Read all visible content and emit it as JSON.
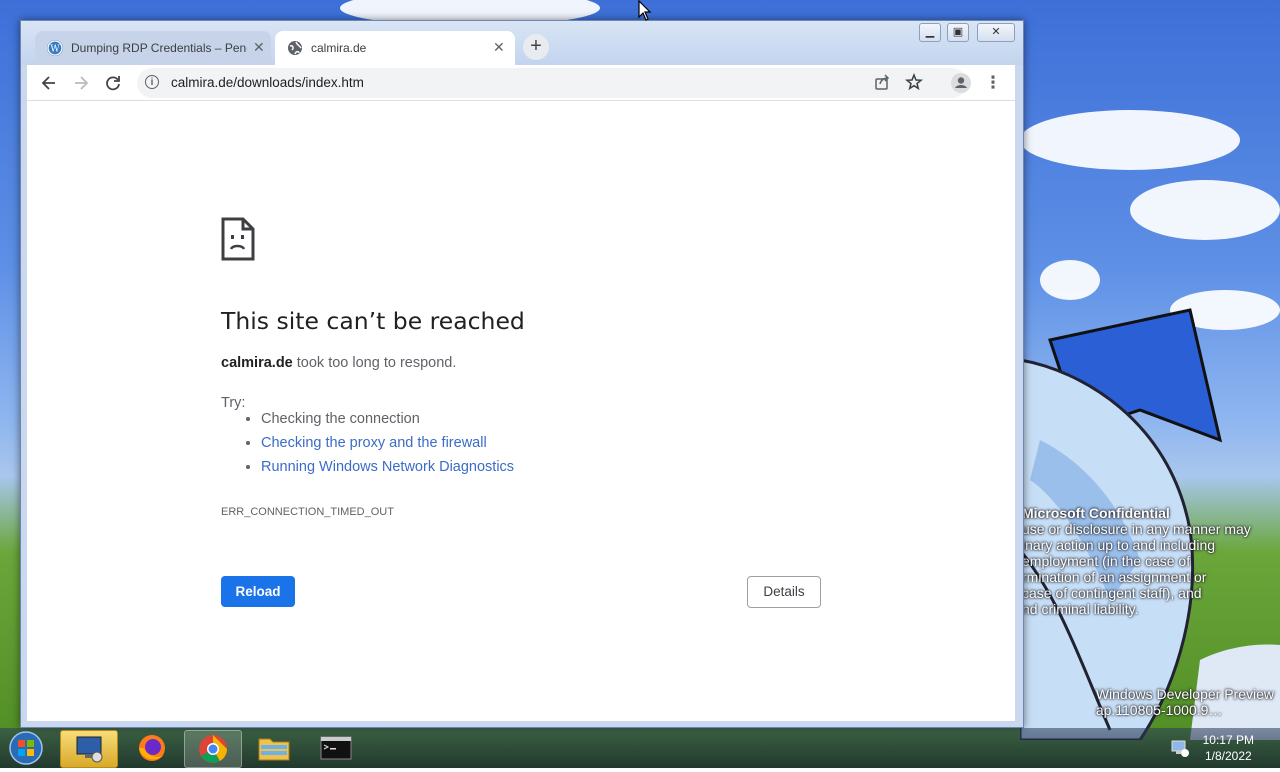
{
  "tabs": [
    {
      "title": "Dumping RDP Credentials – Pene",
      "icon": "wordpress-icon"
    },
    {
      "title": "calmira.de",
      "icon": "globe-icon",
      "active": true
    }
  ],
  "address": {
    "url": "calmira.de/downloads/index.htm"
  },
  "error": {
    "title": "This site can’t be reached",
    "host": "calmira.de",
    "message": " took too long to respond.",
    "try_label": "Try:",
    "suggestions": [
      "Checking the connection",
      "Checking the proxy and the firewall",
      "Running Windows Network Diagnostics"
    ],
    "code": "ERR_CONNECTION_TIMED_OUT",
    "reload_label": "Reload",
    "details_label": "Details"
  },
  "desktop": {
    "watermark_lines": [
      "Microsoft Confidential",
      "use or disclosure in any manner may",
      "inary action up to and including",
      "employment (in the case of",
      "rmination of an assignment or",
      "case of contingent staff), and",
      "nd criminal liability."
    ],
    "build_line1": "Windows Developer Preview",
    "build_line2": "ap.110805-1000.9…"
  },
  "taskbar": {
    "time": "10:17 PM",
    "date": "1/8/2022",
    "apps": [
      "remote-desktop-icon",
      "firefox-icon",
      "chrome-icon",
      "file-explorer-icon",
      "command-prompt-icon"
    ]
  },
  "colors": {
    "link": "#1a73e8",
    "primary_button": "#1a73e8"
  }
}
